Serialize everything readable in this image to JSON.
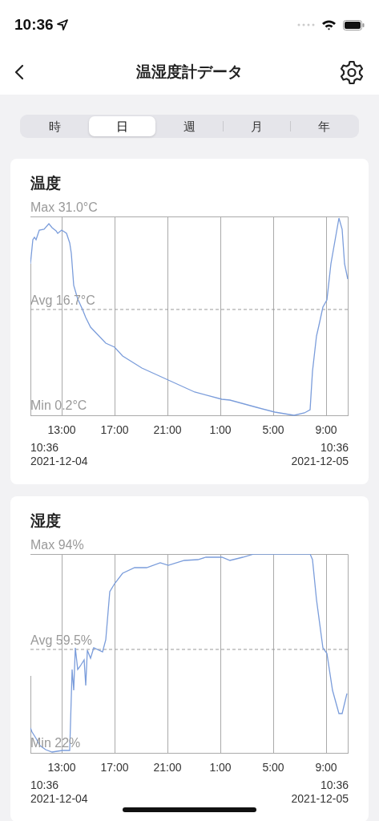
{
  "status_bar": {
    "time": "10:36"
  },
  "nav": {
    "title": "温湿度計データ"
  },
  "tabs": [
    {
      "label": "時",
      "selected": false
    },
    {
      "label": "日",
      "selected": true
    },
    {
      "label": "週",
      "selected": false
    },
    {
      "label": "月",
      "selected": false
    },
    {
      "label": "年",
      "selected": false
    }
  ],
  "cards": [
    {
      "kind": "temperature",
      "title": "温度",
      "max_label": "Max 31.0°C",
      "avg_label": "Avg 16.7°C",
      "min_label": "Min 0.2°C",
      "x_labels": [
        "13:00",
        "17:00",
        "21:00",
        "1:00",
        "5:00",
        "9:00"
      ],
      "start": {
        "time": "10:36",
        "date": "2021-12-04"
      },
      "end": {
        "time": "10:36",
        "date": "2021-12-05"
      }
    },
    {
      "kind": "humidity",
      "title": "湿度",
      "max_label": "Max 94%",
      "avg_label": "Avg 59.5%",
      "min_label": "Min 22%",
      "x_labels": [
        "13:00",
        "17:00",
        "21:00",
        "1:00",
        "5:00",
        "9:00"
      ],
      "start": {
        "time": "10:36",
        "date": "2021-12-04"
      },
      "end": {
        "time": "10:36",
        "date": "2021-12-05"
      }
    }
  ]
}
